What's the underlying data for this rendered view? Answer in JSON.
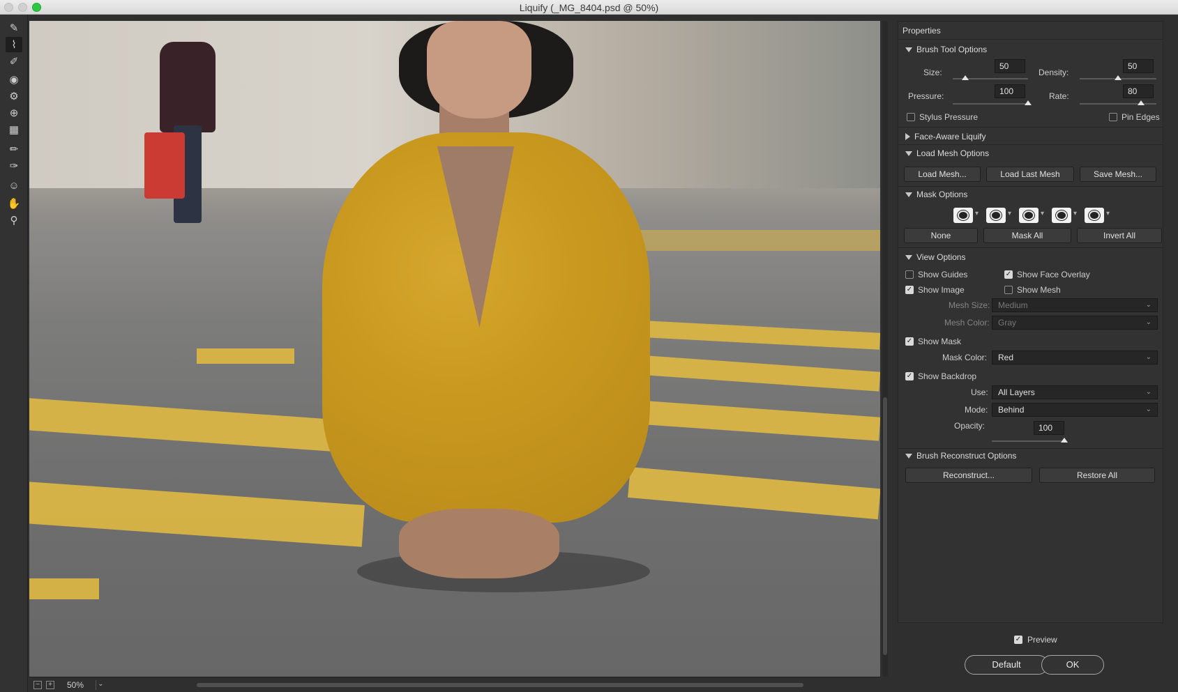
{
  "window": {
    "title": "Liquify (_MG_8404.psd @ 50%)"
  },
  "toolbar": {
    "tools": [
      "forward-warp-tool",
      "reconstruct-tool",
      "smooth-tool",
      "twirl-tool",
      "pucker-tool",
      "bloat-tool",
      "push-left-tool",
      "freeze-mask-tool",
      "thaw-mask-tool",
      "face-tool",
      "hand-tool",
      "zoom-tool"
    ]
  },
  "status": {
    "zoom": "50%"
  },
  "panel": {
    "title": "Properties",
    "brush": {
      "header": "Brush Tool Options",
      "size_label": "Size:",
      "size": "50",
      "size_pct": 0.17,
      "density_label": "Density:",
      "density": "50",
      "density_pct": 0.5,
      "pressure_label": "Pressure:",
      "pressure": "100",
      "pressure_pct": 1.0,
      "rate_label": "Rate:",
      "rate": "80",
      "rate_pct": 0.8,
      "stylus_label": "Stylus Pressure",
      "stylus_checked": false,
      "pin_label": "Pin Edges",
      "pin_checked": false
    },
    "face_aware": {
      "header": "Face-Aware Liquify"
    },
    "load_mesh": {
      "header": "Load Mesh Options",
      "load_mesh": "Load Mesh...",
      "load_last_mesh": "Load Last Mesh",
      "save_mesh": "Save Mesh..."
    },
    "mask": {
      "header": "Mask Options",
      "none": "None",
      "mask_all": "Mask All",
      "invert_all": "Invert All"
    },
    "view": {
      "header": "View Options",
      "show_guides": "Show Guides",
      "show_face_overlay": "Show Face Overlay",
      "show_image": "Show Image",
      "show_mesh": "Show Mesh",
      "mesh_size_label": "Mesh Size:",
      "mesh_size": "Medium",
      "mesh_color_label": "Mesh Color:",
      "mesh_color": "Gray",
      "show_mask": "Show Mask",
      "mask_color_label": "Mask Color:",
      "mask_color": "Red",
      "show_backdrop": "Show Backdrop",
      "use_label": "Use:",
      "use": "All Layers",
      "mode_label": "Mode:",
      "mode": "Behind",
      "opacity_label": "Opacity:",
      "opacity": "100",
      "opacity_pct": 1.0
    },
    "reconstruct": {
      "header": "Brush Reconstruct Options",
      "reconstruct": "Reconstruct...",
      "restore_all": "Restore All"
    }
  },
  "footer": {
    "preview": "Preview",
    "default": "Default",
    "ok": "OK"
  },
  "colors": {
    "accent_green": "#2dc83f",
    "panel_bg": "#323232",
    "stripe_yellow": "#d9b545"
  }
}
